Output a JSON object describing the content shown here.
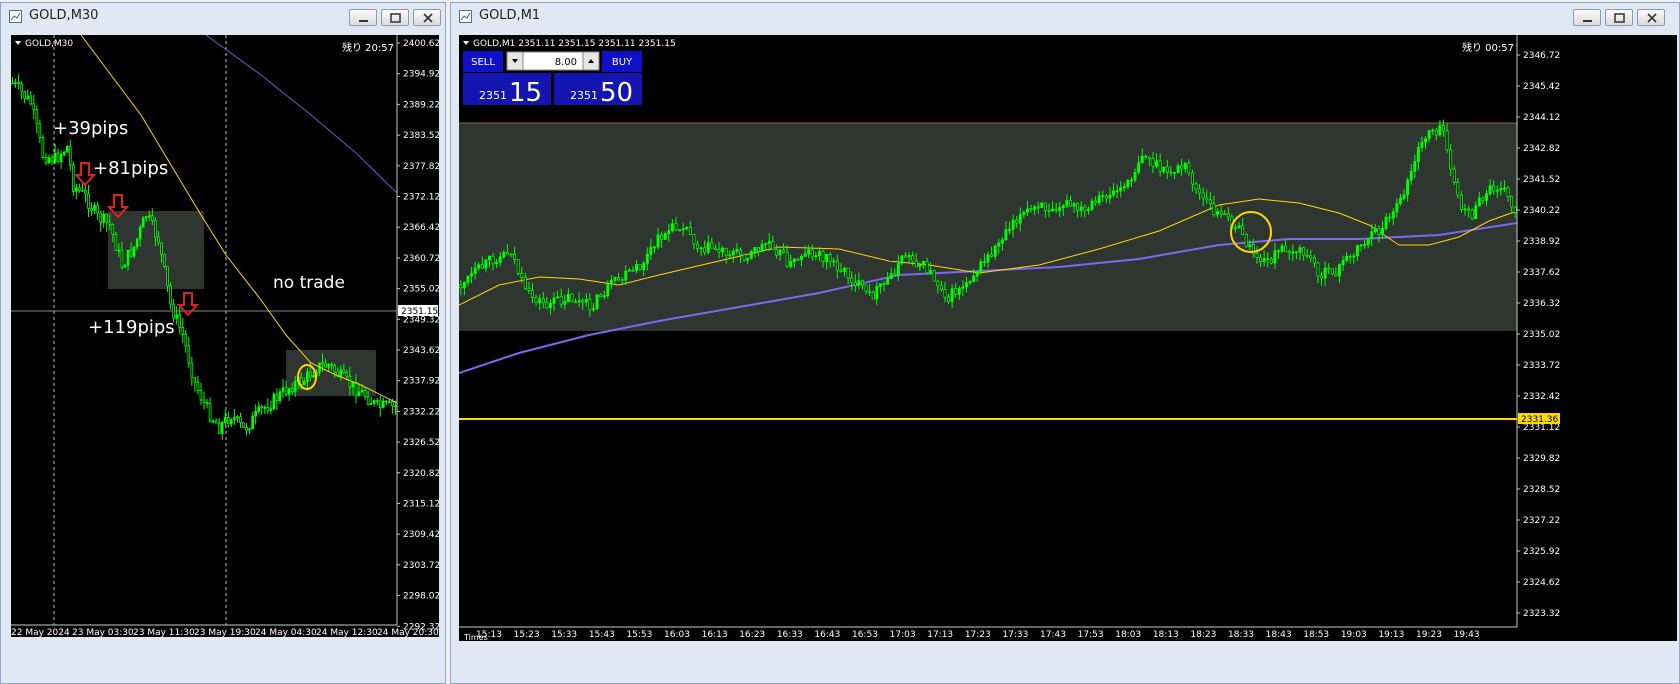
{
  "left_window": {
    "title": "GOLD,M30",
    "symbol_label": "GOLD,M30",
    "remaining": "残り 20:57",
    "price_ticks": [
      "2400.62",
      "2394.92",
      "2389.22",
      "2383.52",
      "2377.82",
      "2372.12",
      "2366.42",
      "2360.72",
      "2355.02",
      "2349.32",
      "2343.62",
      "2337.92",
      "2332.22",
      "2326.52",
      "2320.82",
      "2315.12",
      "2309.42",
      "2303.72",
      "2298.02",
      "2292.32"
    ],
    "current_price": "2351.15",
    "time_ticks": [
      "22 May 2024",
      "23 May 03:30",
      "23 May 11:30",
      "23 May 19:30",
      "24 May 04:30",
      "24 May 12:30",
      "24 May 20:30"
    ],
    "annotations": {
      "pips1": "+39pips",
      "pips2": "+81pips",
      "pips3": "+119pips",
      "no_trade": "no trade"
    },
    "colors": {
      "candle": "#00ff00",
      "ma_fast": "#ffd700",
      "ma_slow": "#6a5acd",
      "arrow": "#e02020"
    }
  },
  "right_window": {
    "title": "GOLD,M1",
    "quote_line": "GOLD,M1  2351.11 2351.15 2351.11 2351.15",
    "remaining": "残り 00:57",
    "trade_panel": {
      "sell_label": "SELL",
      "buy_label": "BUY",
      "lot_value": "8.00",
      "sell_price_small": "2351",
      "sell_price_big": "15",
      "buy_price_small": "2351",
      "buy_price_big": "50"
    },
    "price_ticks": [
      "2346.72",
      "2345.42",
      "2344.12",
      "2342.82",
      "2341.52",
      "2340.22",
      "2338.92",
      "2337.62",
      "2336.32",
      "2335.02",
      "2333.72",
      "2332.42",
      "2331.12",
      "2329.82",
      "2328.52",
      "2327.22",
      "2325.92",
      "2324.62",
      "2323.32"
    ],
    "level_price": "2331.36",
    "time_ticks": [
      "15:13",
      "15:23",
      "15:33",
      "15:43",
      "15:53",
      "16:03",
      "16:13",
      "16:23",
      "16:33",
      "16:43",
      "16:53",
      "17:03",
      "17:13",
      "17:23",
      "17:33",
      "17:43",
      "17:53",
      "18:03",
      "18:13",
      "18:23",
      "18:33",
      "18:43",
      "18:53",
      "19:03",
      "19:13",
      "19:23",
      "19:43"
    ],
    "times_label": "Times",
    "colors": {
      "candle": "#00ff00",
      "ma_fast": "#ffd700",
      "ma_slow": "#7b68ee",
      "level": "#ffd700",
      "panel": "#1010c8"
    }
  }
}
